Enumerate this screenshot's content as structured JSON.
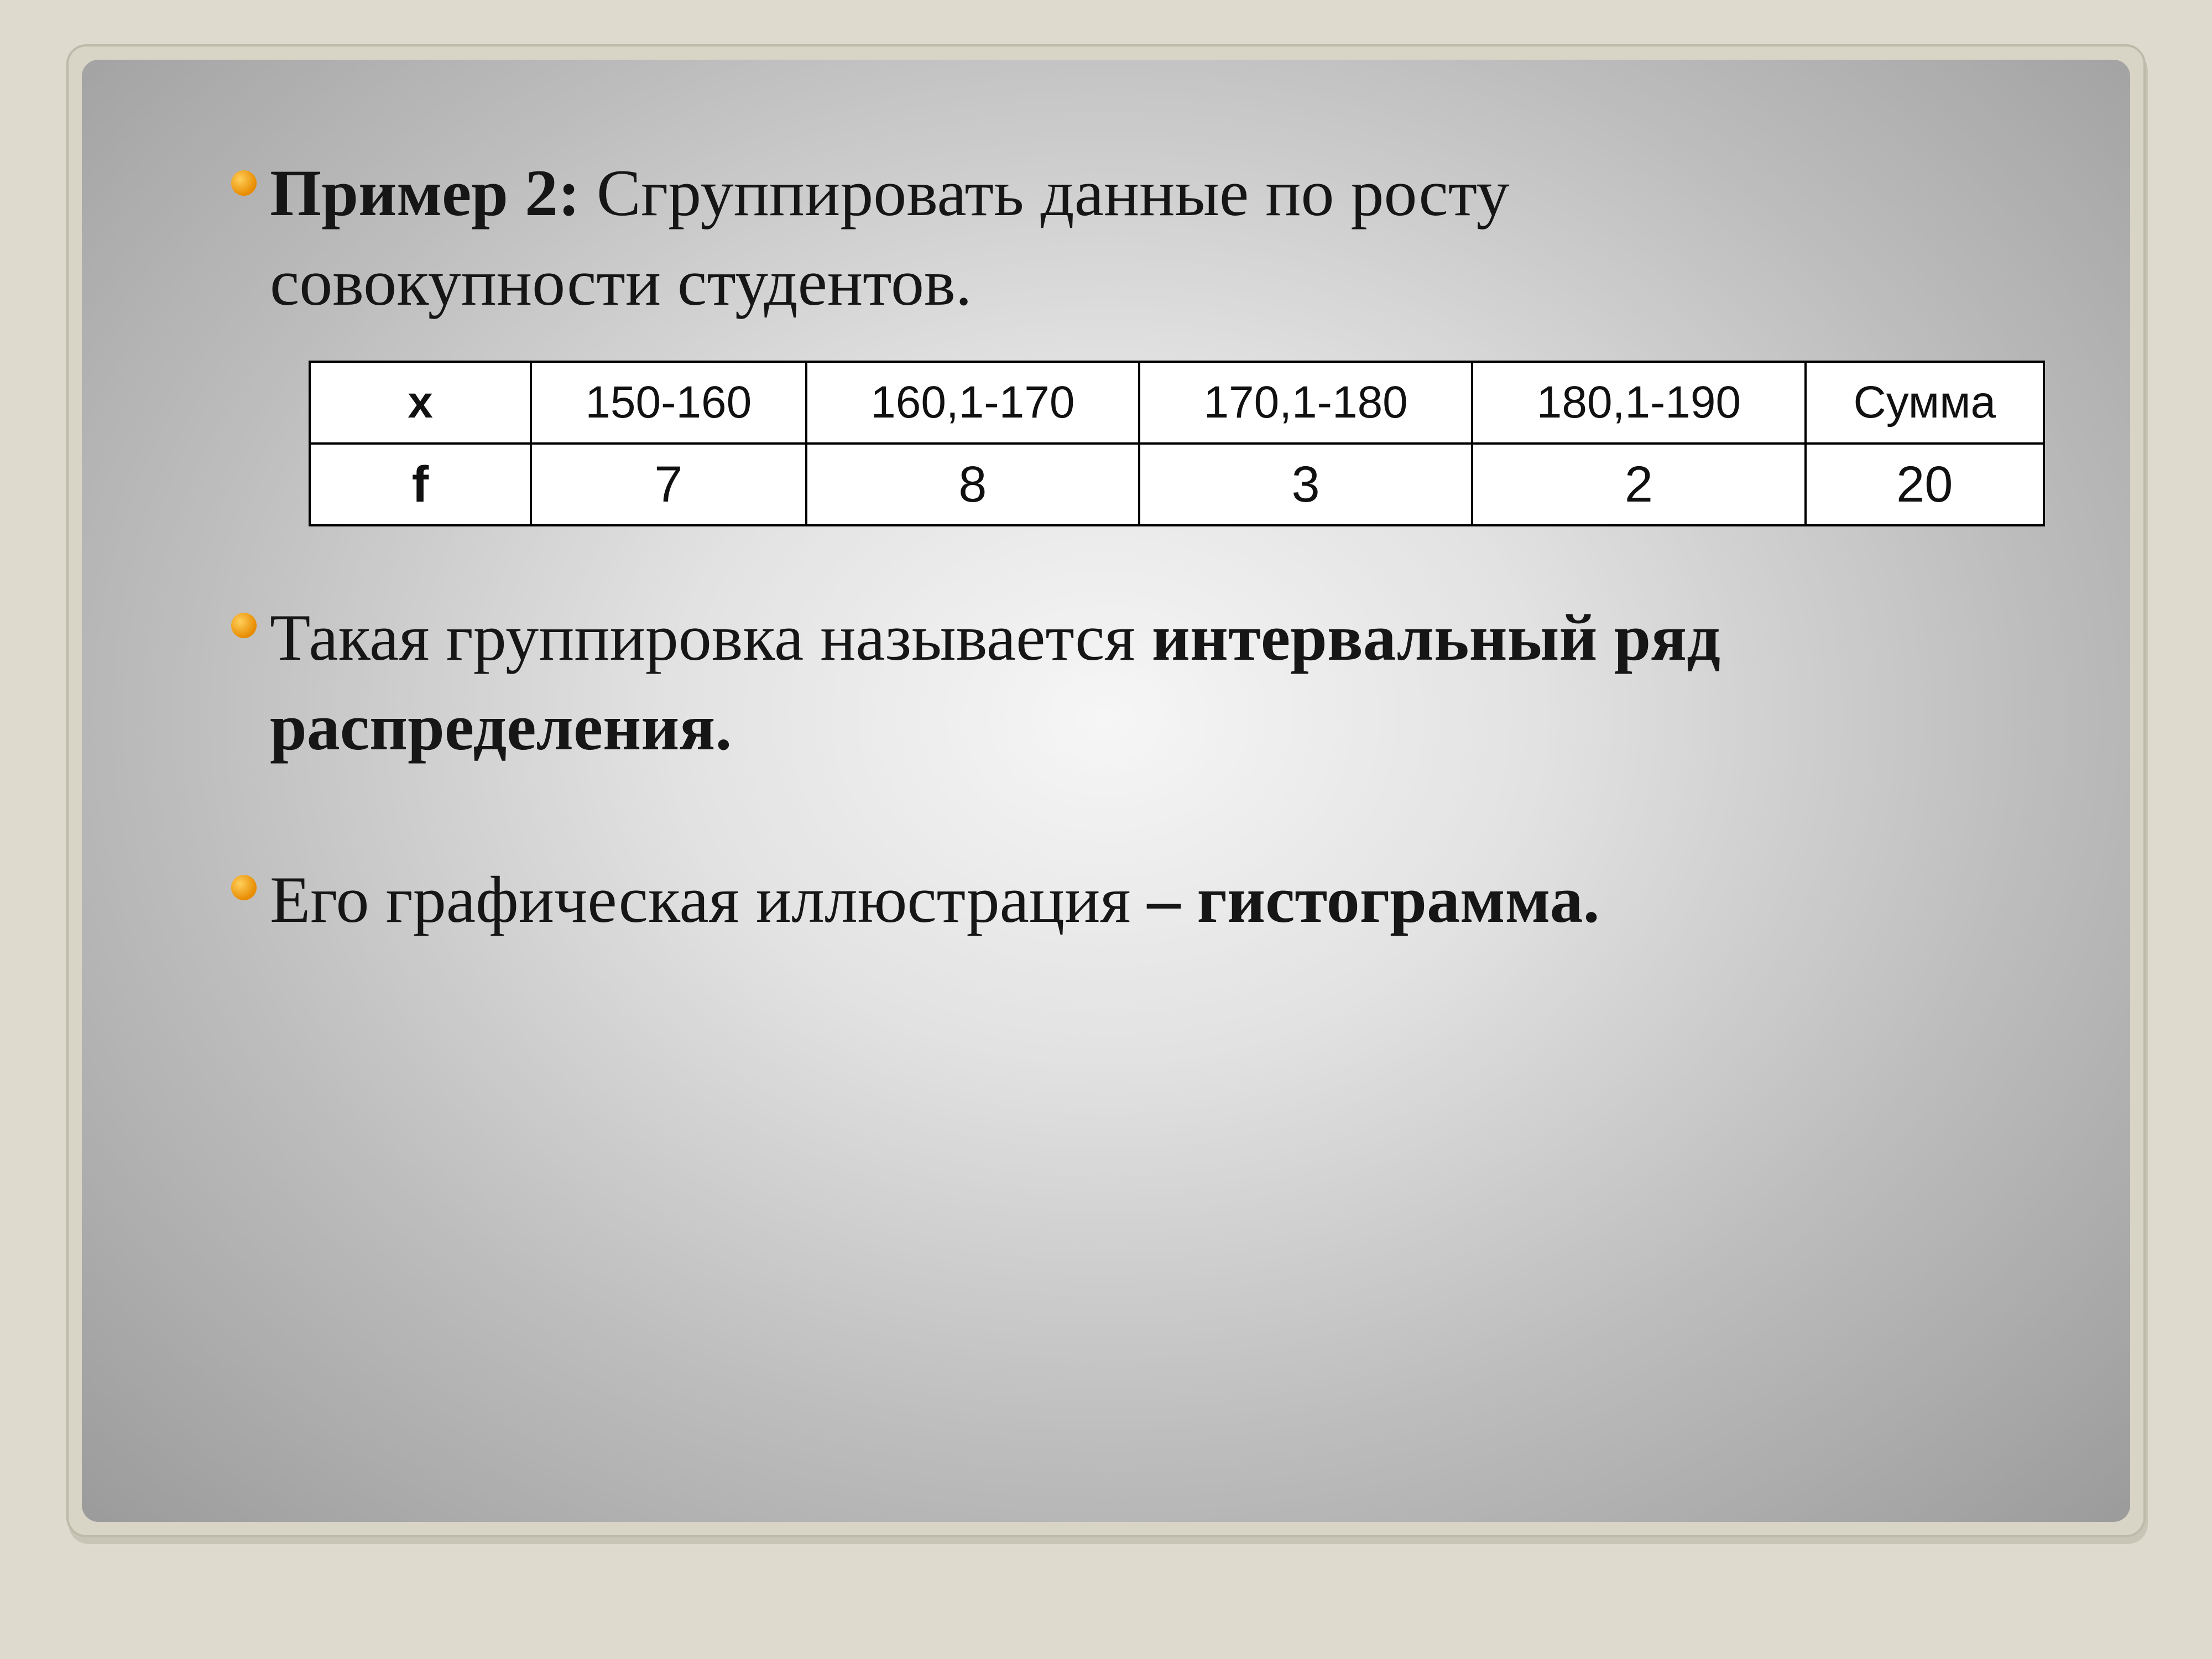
{
  "bullets": {
    "b1_label": "Пример 2:",
    "b1_rest1": "  Сгруппировать данные по росту",
    "b1_rest2": "совокупности студентов.",
    "b2_plain": "Такая группировка называется ",
    "b2_bold": "интервальный ряд распределения.",
    "b3_plain": "Его графическая иллюстрация",
    "b3_bold": " – гистограмма."
  },
  "chart_data": {
    "type": "table",
    "title": "",
    "row_headers": [
      "x",
      "f"
    ],
    "categories": [
      "150-160",
      "160,1-170",
      "170,1-180",
      "180,1-190",
      "Сумма"
    ],
    "values": [
      "7",
      "8",
      "3",
      "2",
      "20"
    ]
  }
}
